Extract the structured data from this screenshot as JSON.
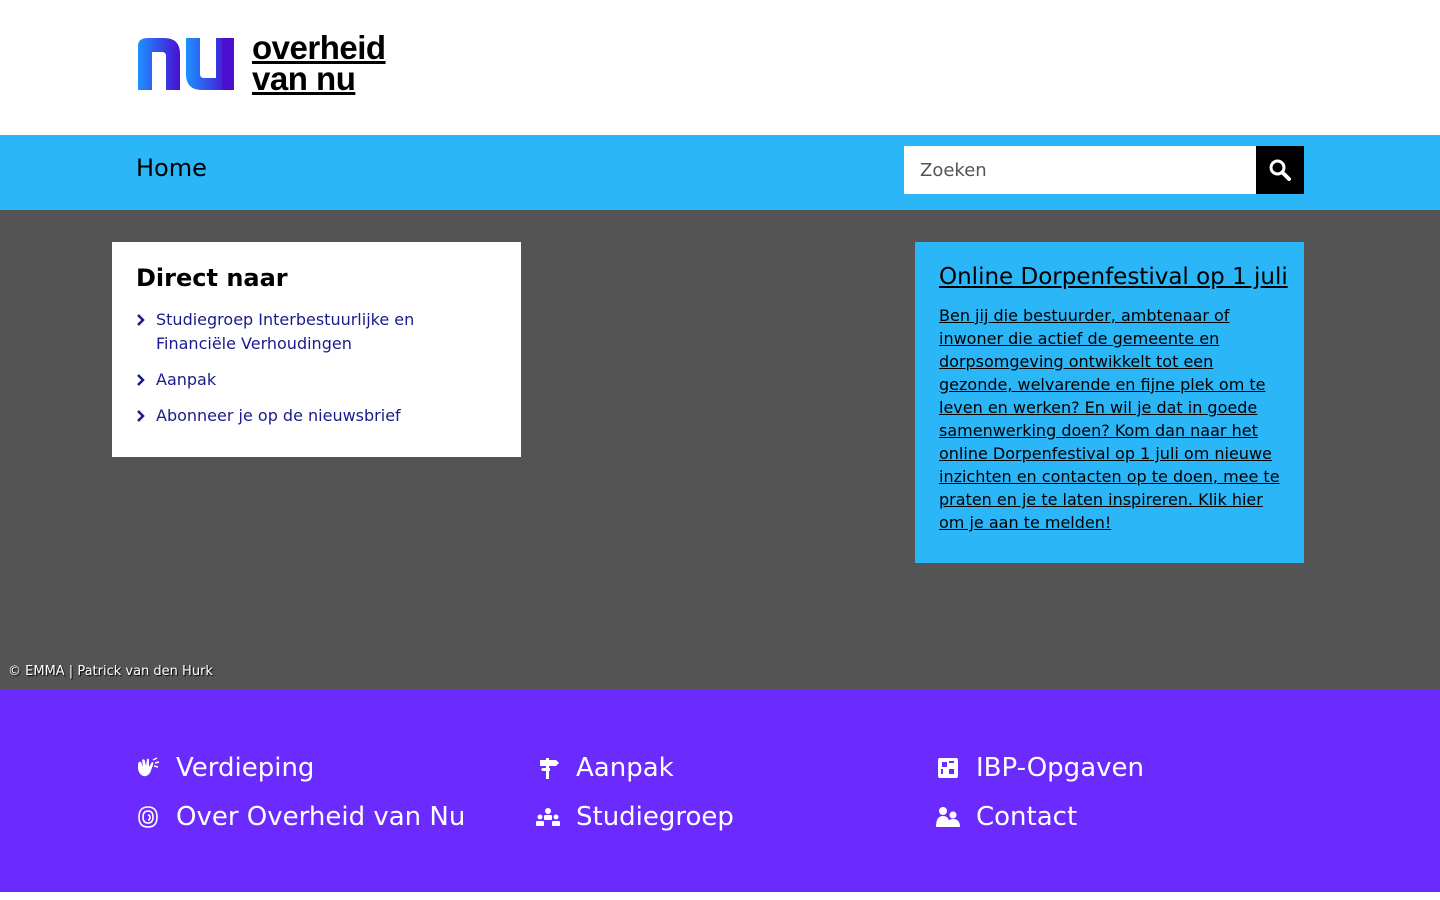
{
  "brand": {
    "line1": "overheid",
    "line2": "van nu",
    "colors": {
      "gradient_start": "#1e90ff",
      "gradient_end": "#4a0fd1"
    }
  },
  "nav": {
    "home_label": "Home",
    "search": {
      "placeholder": "Zoeken",
      "value": ""
    },
    "search_icon": "search-icon"
  },
  "direct_naar": {
    "title": "Direct naar",
    "items": [
      {
        "label": "Studiegroep Interbestuurlijke en Financiële Verhoudingen"
      },
      {
        "label": "Aanpak"
      },
      {
        "label": "Abonneer je op de nieuwsbrief"
      }
    ]
  },
  "promo": {
    "title": "Online Dorpenfestival op 1 juli",
    "body": "Ben jij die bestuurder, ambtenaar of inwoner die actief de gemeente en dorpsomgeving ontwikkelt tot een gezonde, welvarende en fijne plek om te leven en werken? En wil je dat in goede samenwerking doen? Kom dan naar het online Dorpenfestival op 1 juli om nieuwe inzichten en contacten op te doen, mee te praten en je te laten inspireren. Klik hier om je aan te melden!"
  },
  "credit": "© EMMA | Patrick van den Hurk",
  "footer": {
    "links": [
      {
        "label": "Verdieping",
        "icon": "hands-icon"
      },
      {
        "label": "Aanpak",
        "icon": "signpost-icon"
      },
      {
        "label": "IBP-Opgaven",
        "icon": "puzzle-icon"
      },
      {
        "label": "Over Overheid van Nu",
        "icon": "fingerprint-icon"
      },
      {
        "label": "Studiegroep",
        "icon": "group-icon"
      },
      {
        "label": "Contact",
        "icon": "people-icon"
      }
    ]
  },
  "colors": {
    "nav_bg": "#2bb6f8",
    "hero_bg": "#545454",
    "footer_bg": "#6b2bff",
    "link": "#1a1a8c"
  }
}
